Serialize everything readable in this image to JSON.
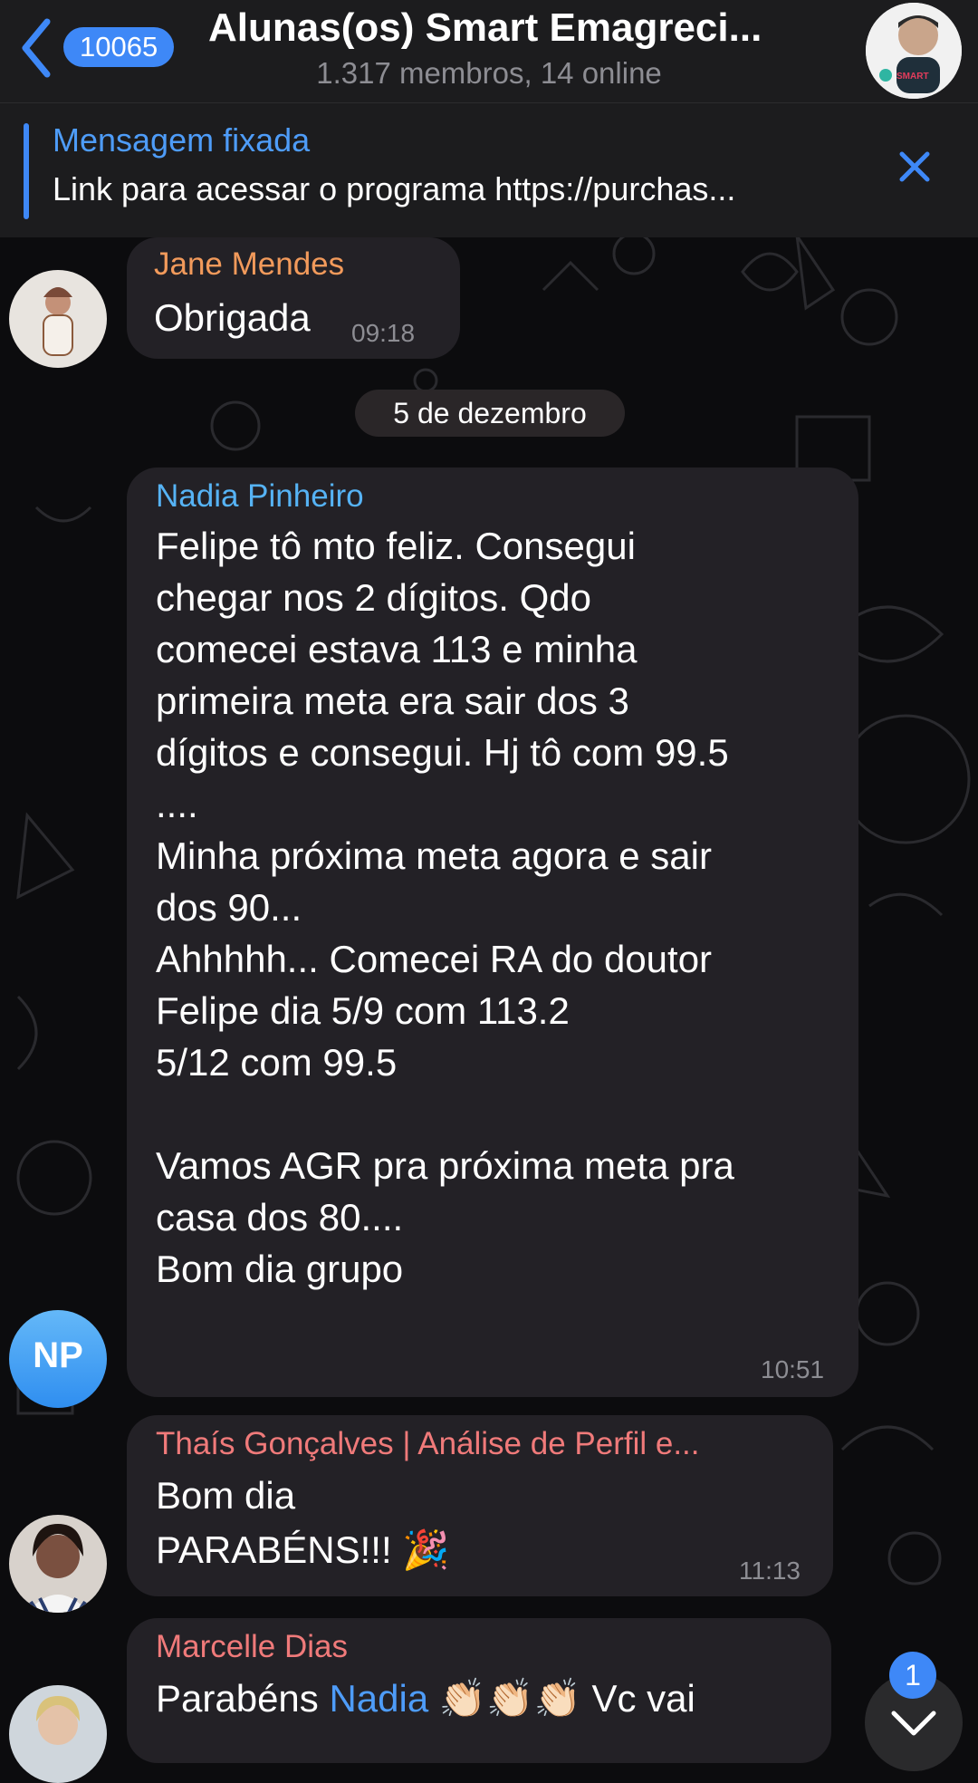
{
  "header": {
    "back_count": "10065",
    "title": "Alunas(os) Smart Emagreci...",
    "subtitle": "1.317 membros, 14 online",
    "avatar_text": "SMART"
  },
  "pinned": {
    "label": "Mensagem fixada",
    "text": "Link para acessar o programa https://purchas..."
  },
  "messages": [
    {
      "sender": "Jane Mendes",
      "sender_color": "#f29a5b",
      "text": "Obrigada",
      "time": "09:18"
    },
    {
      "sender": "Nadia Pinheiro",
      "sender_color": "#56b3f5",
      "avatar_initials": "NP",
      "text": "Felipe tô mto feliz. Consegui\nchegar nos 2 dígitos. Qdo\ncomecei estava 113 e minha\nprimeira meta era sair dos 3\ndígitos e consegui. Hj tô com 99.5\n....\nMinha próxima meta agora e sair\ndos 90...\nAhhhhh... Comecei  RA do doutor\nFelipe dia 5/9 com 113.2\n5/12 com 99.5\n\nVamos AGR pra próxima meta  pra\ncasa dos 80....\nBom dia grupo",
      "time": "10:51"
    },
    {
      "sender": "Thaís Gonçalves | Análise de Perfil e...",
      "sender_color": "#f07a7a",
      "text_line1": "Bom dia",
      "text_line2": "PARABÉNS!!! 🎉",
      "time": "11:13"
    },
    {
      "sender": "Marcelle Dias",
      "sender_color": "#f07a7a",
      "text_prefix": "Parabéns ",
      "mention": "Nadia",
      "text_suffix": " 👏🏻👏🏻👏🏻 Vc vai"
    }
  ],
  "date_separator": "5 de dezembro",
  "scroll_badge": "1",
  "colors": {
    "accent": "#3e88f7",
    "header_bg": "#1c1c1e",
    "bubble_bg": "#232126",
    "chat_bg": "#0c0c0e"
  }
}
